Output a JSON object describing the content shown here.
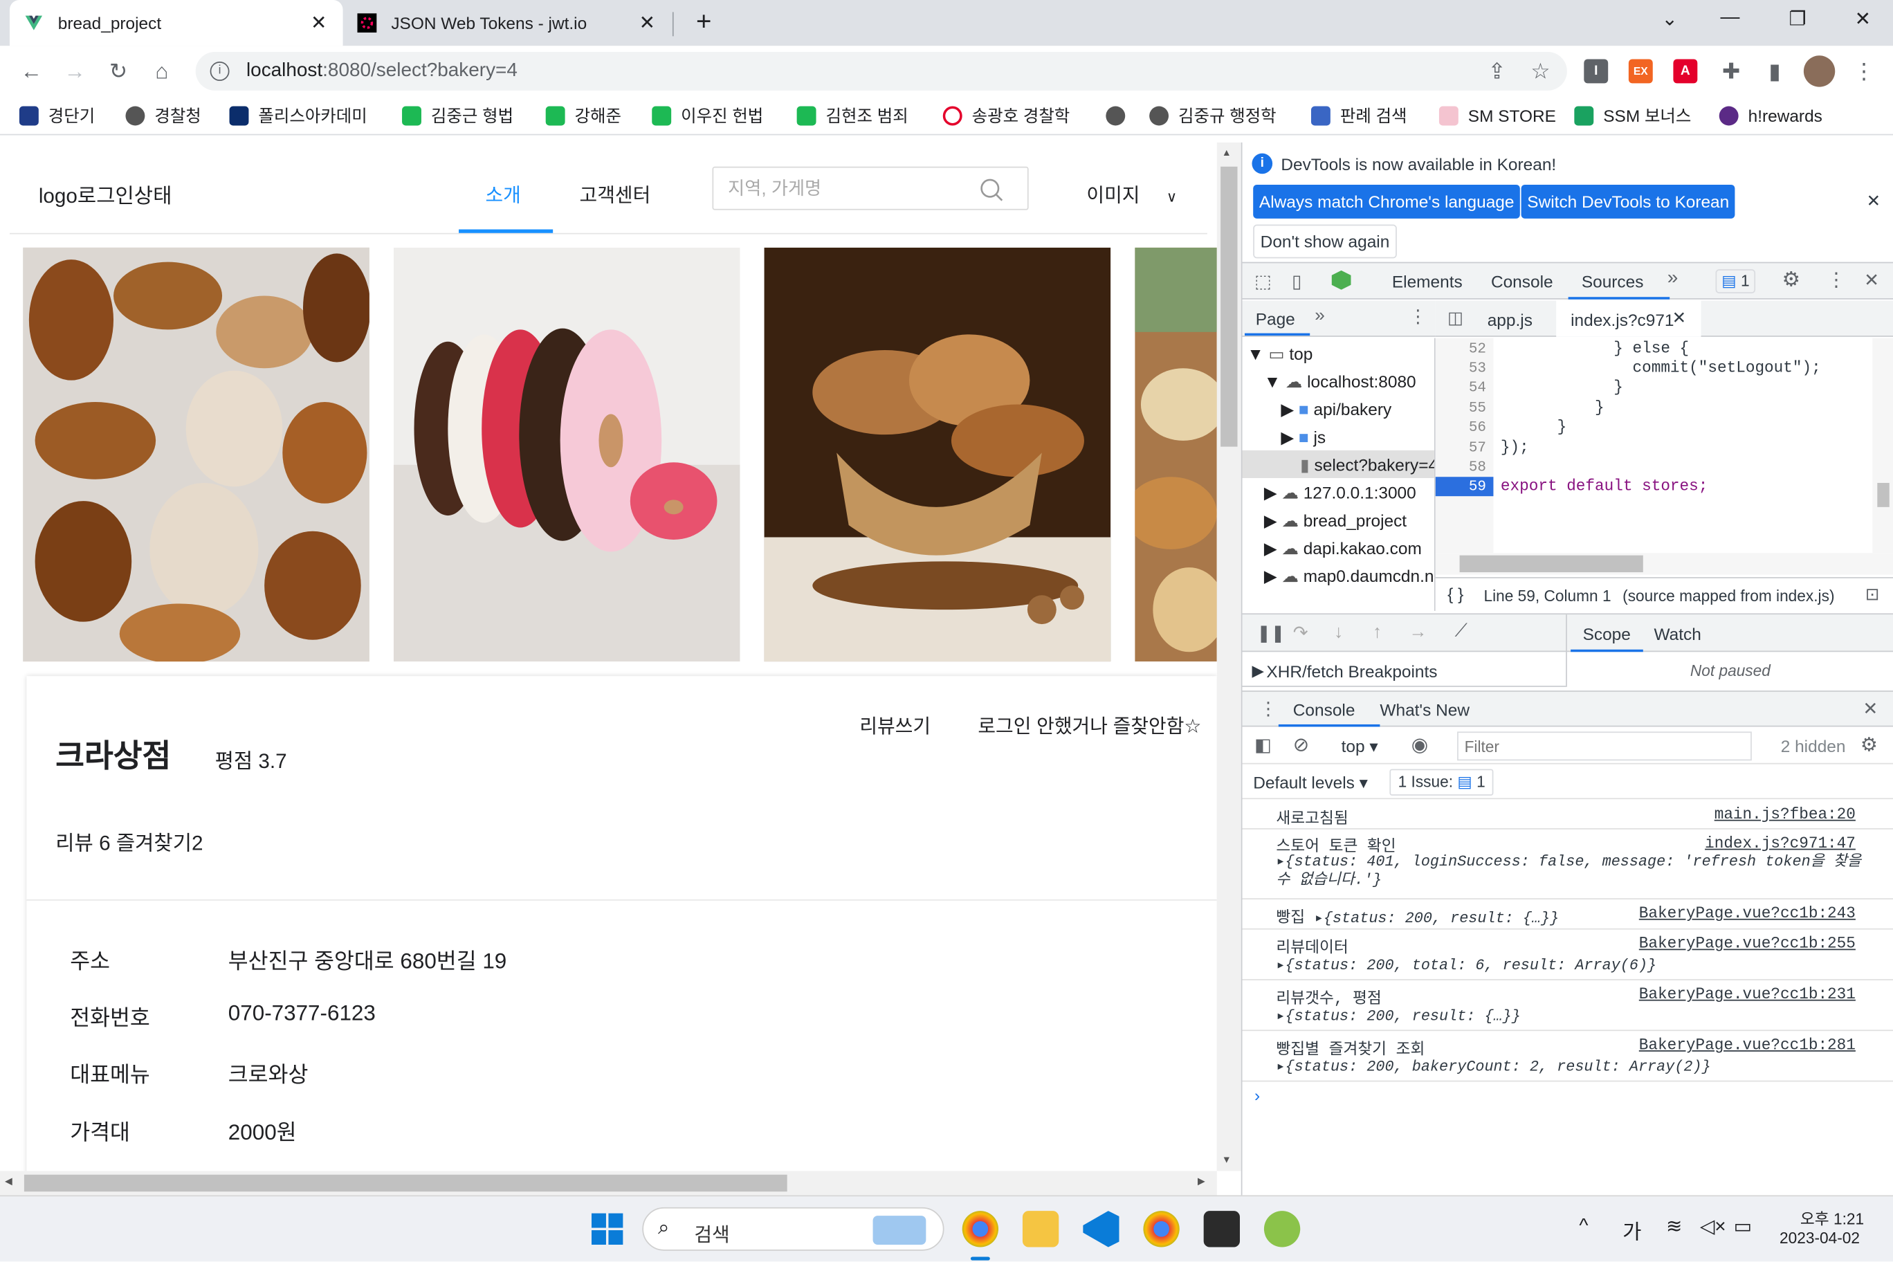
{
  "browser": {
    "tabs": [
      {
        "title": "bread_project",
        "active": true
      },
      {
        "title": "JSON Web Tokens - jwt.io",
        "active": false
      }
    ],
    "url_host": "localhost",
    "url_rest": ":8080/select?bakery=4",
    "bookmarks": [
      "경단기",
      "경찰청",
      "폴리스아카데미",
      "김중근 형법",
      "강해준",
      "이우진 헌법",
      "김현조 범죄",
      "송광호 경찰학",
      "김중규 행정학",
      "판례 검색",
      "SM STORE",
      "SSM 보너스",
      "h!rewards"
    ]
  },
  "site": {
    "logo": "logo로그인상태",
    "nav_tabs": [
      "소개",
      "고객센터"
    ],
    "search_placeholder": "지역, 가게명",
    "image_menu": "이미지",
    "shop_name": "크라상점",
    "rating": "평점 3.7",
    "review_write": "리뷰쓰기",
    "login_state": "로그인 안했거나 즐찾안함☆",
    "review_count": "리뷰 6 즐겨찾기2",
    "info": [
      {
        "label": "주소",
        "value": "부산진구 중앙대로 680번길 19"
      },
      {
        "label": "전화번호",
        "value": "070-7377-6123"
      },
      {
        "label": "대표메뉴",
        "value": "크로와상"
      },
      {
        "label": "가격대",
        "value": "2000원"
      }
    ]
  },
  "devtools": {
    "notice": "DevTools is now available in Korean!",
    "btn_match": "Always match Chrome's language",
    "btn_switch": "Switch DevTools to Korean",
    "btn_dont": "Don't show again",
    "tabs": [
      "Elements",
      "Console",
      "Sources"
    ],
    "issue_count": "1",
    "page_tab": "Page",
    "file_tabs": [
      "app.js",
      "index.js?c971"
    ],
    "tree": [
      "top",
      "localhost:8080",
      "api/bakery",
      "js",
      "select?bakery=4",
      "127.0.0.1:3000",
      "bread_project",
      "dapi.kakao.com",
      "map0.daumcdn.net"
    ],
    "code": [
      {
        "n": "52",
        "t": "            } else {"
      },
      {
        "n": "53",
        "t": "              commit(\"setLogout\");"
      },
      {
        "n": "54",
        "t": "            }"
      },
      {
        "n": "55",
        "t": "          }"
      },
      {
        "n": "56",
        "t": "      }"
      },
      {
        "n": "57",
        "t": "});"
      },
      {
        "n": "58",
        "t": ""
      },
      {
        "n": "59",
        "t": "export default stores;"
      }
    ],
    "status_line": "Line 59, Column 1",
    "status_src": "(source mapped from index.js)",
    "scope": "Scope",
    "watch": "Watch",
    "not_paused": "Not paused",
    "xhr": "XHR/fetch Breakpoints",
    "console_tab": "Console",
    "whatsnew_tab": "What's New",
    "ctx": "top",
    "filter_placeholder": "Filter",
    "hidden": "2 hidden",
    "levels": "Default levels",
    "issue_label": "1 Issue:",
    "logs": [
      {
        "msg": "새로고침됨",
        "src": "main.js?fbea:20",
        "detail": ""
      },
      {
        "msg": "스토어 토큰 확인",
        "src": "index.js?c971:47",
        "detail": "{status: 401, loginSuccess: false, message: 'refresh token을 찾을 수 없습니다.'}"
      },
      {
        "msg": "빵집",
        "src": "BakeryPage.vue?cc1b:243",
        "detail": "{status: 200, result: {…}}"
      },
      {
        "msg": "리뷰데이터",
        "src": "BakeryPage.vue?cc1b:255",
        "detail": "{status: 200, total: 6, result: Array(6)}"
      },
      {
        "msg": "리뷰갯수, 평점",
        "src": "BakeryPage.vue?cc1b:231",
        "detail": "{status: 200, result: {…}}"
      },
      {
        "msg": "빵집별 즐겨찾기 조회",
        "src": "BakeryPage.vue?cc1b:281",
        "detail": "{status: 200, bakeryCount: 2, result: Array(2)}"
      }
    ]
  },
  "taskbar": {
    "search": "검색",
    "ime": "가",
    "time": "오후 1:21",
    "date": "2023-04-02"
  }
}
